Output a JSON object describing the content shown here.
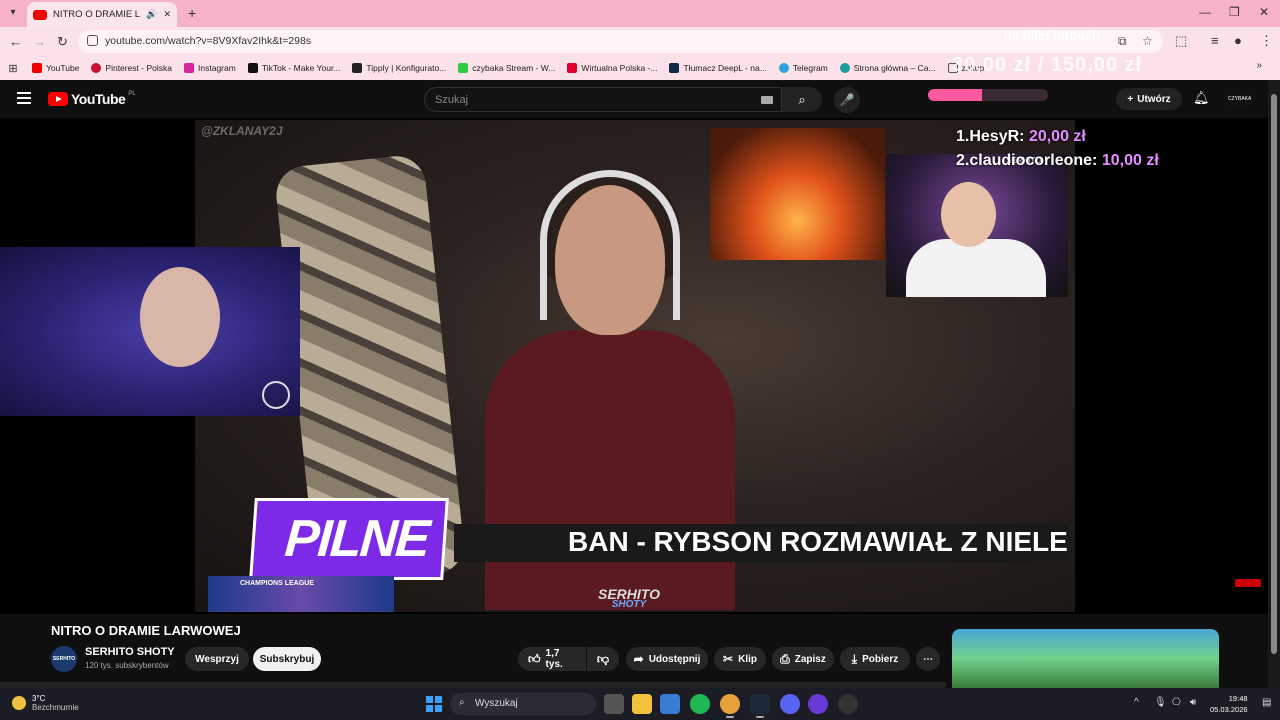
{
  "browser": {
    "tab_title": "NITRO O DRAMIE LARWOWEJ",
    "url": "youtube.com/watch?v=8V9Xfav2Ihk&t=298s",
    "bookmarks": [
      "YouTube",
      "Pinterest - Polska",
      "Instagram",
      "TikTok - Make Your...",
      "Tipply | Konfigurato...",
      "czybaka Stream - W...",
      "Wirtualna Polska -...",
      "Tłumacz DeepL - na...",
      "Telegram",
      "Strona główna – Ca...",
      "zakup"
    ]
  },
  "youtube": {
    "logo": "YouTube",
    "region": "PL",
    "search_placeholder": "Szukaj",
    "create_label": "Utwórz",
    "avatar_text": "CZYBAKA"
  },
  "stream_overlay": {
    "goal_text": "na bilet intouch",
    "goal_amounts": "30,00 zł / 150,00 zł",
    "donations": [
      {
        "rank": "1.",
        "name": "HesyR:",
        "amount": "20,00 zł"
      },
      {
        "rank": "2.",
        "name": "claudiocorleone:",
        "amount": "10,00 zł"
      }
    ],
    "watermark": "@ZKLANAY2J",
    "cam_label": "SERHITO",
    "banner_pilne": "PILNE",
    "ticker_text": "BAN - RYBSON ROZMAWIAŁ Z NIELETNIM",
    "league_text": "CHAMPIONS LEAGUE",
    "serhito_wm_top": "SERHITO",
    "serhito_wm_bottom": "SHOTY"
  },
  "video": {
    "title": "NITRO O DRAMIE LARWOWEJ",
    "channel_name": "SERHITO SHOTY",
    "channel_avatar_text": "SERHITO",
    "subscribers": "120 tys. subskrybentów",
    "support_label": "Wesprzyj",
    "subscribe_label": "Subskrybuj",
    "likes": "1,7 tys.",
    "share_label": "Udostępnij",
    "clip_label": "Klip",
    "save_label": "Zapisz",
    "download_label": "Pobierz"
  },
  "taskbar": {
    "temp": "3°C",
    "weather": "Bezchmurnie",
    "search_label": "Wyszukaj",
    "time": "19:48",
    "date": "05.03.2026"
  },
  "colors": {
    "accent": "#ff0000",
    "chrome": "#f6b2c8",
    "pilne": "#7d2ae8",
    "donation_amount": "#e58cff"
  }
}
